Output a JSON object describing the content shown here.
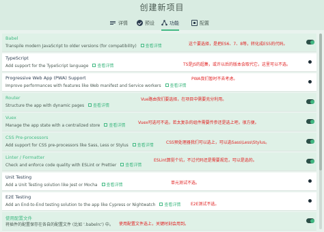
{
  "page": {
    "title": "创建新项目"
  },
  "tabs": [
    {
      "label": "详情",
      "icon": "details-icon"
    },
    {
      "label": "预设",
      "icon": "check-circle-icon"
    },
    {
      "label": "功能",
      "icon": "features-icon",
      "active": true
    },
    {
      "label": "配置",
      "icon": "config-icon"
    }
  ],
  "more_label": "查看详情",
  "features": [
    {
      "name": "Babel",
      "desc": "Transpile modern JavaScript to older versions (for compatibility)",
      "has_link": true,
      "enabled": true,
      "note": "这个要选择，是把ES6、7、8等，转化成ES5的代码。"
    },
    {
      "name": "TypeScript",
      "desc": "Add support for the TypeScript language",
      "has_link": true,
      "enabled": false,
      "note": "TS是JS的超集，或许以后的版本会取代它，这里可以不选。"
    },
    {
      "name": "Progressive Web App (PWA) Support",
      "desc": "Improve performances with features like Web manifest and Service workers",
      "has_link": true,
      "enabled": false,
      "note": "PWA我们暂时不去考虑。"
    },
    {
      "name": "Router",
      "desc": "Structure the app with dynamic pages",
      "has_link": true,
      "enabled": true,
      "note": "Vue路由我们要选择，在项目中需要充分利用。"
    },
    {
      "name": "Vuex",
      "desc": "Manage the app state with a centralized store",
      "has_link": true,
      "enabled": true,
      "note": "Vuex可选可不选，若太复杂的组件需要传参还是选上吧，很方便。"
    },
    {
      "name": "CSS Pre-processors",
      "desc": "Add support for CSS pre-processors like Sass, Less or Stylus",
      "has_link": true,
      "enabled": true,
      "note": "CSS预处理器我们可以选上，可以选Sass\\Less\\Stylus。"
    },
    {
      "name": "Linter / Formatter",
      "desc": "Check and enforce code quality with ESLint or Prettier",
      "has_link": true,
      "enabled": true,
      "note": "ESLint算挺个坑，不过代码还是需要规范，可以是选的。"
    },
    {
      "name": "Unit Testing",
      "desc": "Add a Unit Testing solution like Jest or Mocha",
      "has_link": true,
      "enabled": false,
      "note": "单元测试不选。"
    },
    {
      "name": "E2E Testing",
      "desc": "Add an End-to-End testing solution to the app like Cypress or Nightwatch",
      "has_link": true,
      "enabled": false,
      "note": "E2E测试不选。"
    },
    {
      "name": "使用配置文件",
      "desc": "将插件的配置保存在各自的配置文件 (比如 '.babelrc') 中。",
      "has_link": false,
      "enabled": true,
      "note": "使用配置文件选上，关键时刻会用到。"
    }
  ],
  "colors": {
    "accent": "#42b983",
    "note": "#e02020",
    "header_bg": "#d9ece2"
  }
}
